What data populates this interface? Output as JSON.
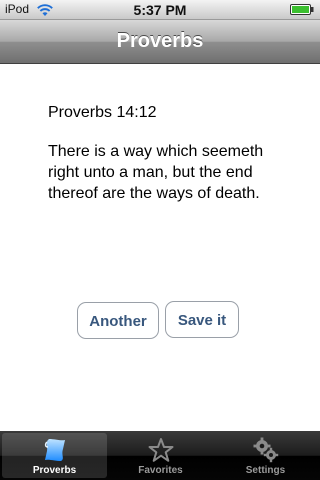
{
  "status_bar": {
    "carrier": "iPod",
    "time": "5:37 PM"
  },
  "nav": {
    "title": "Proverbs"
  },
  "content": {
    "reference": "Proverbs 14:12",
    "verse": "There is a way which seemeth right unto a man, but the end thereof are the ways of death."
  },
  "buttons": {
    "another_label": "Another",
    "save_label": "Save it"
  },
  "tabs": [
    {
      "label": "Proverbs",
      "icon": "scroll-icon",
      "active": true
    },
    {
      "label": "Favorites",
      "icon": "star-icon",
      "active": false
    },
    {
      "label": "Settings",
      "icon": "gears-icon",
      "active": false
    }
  ],
  "colors": {
    "button_text": "#38577d",
    "tab_active_icon": "#4aa3ff"
  }
}
